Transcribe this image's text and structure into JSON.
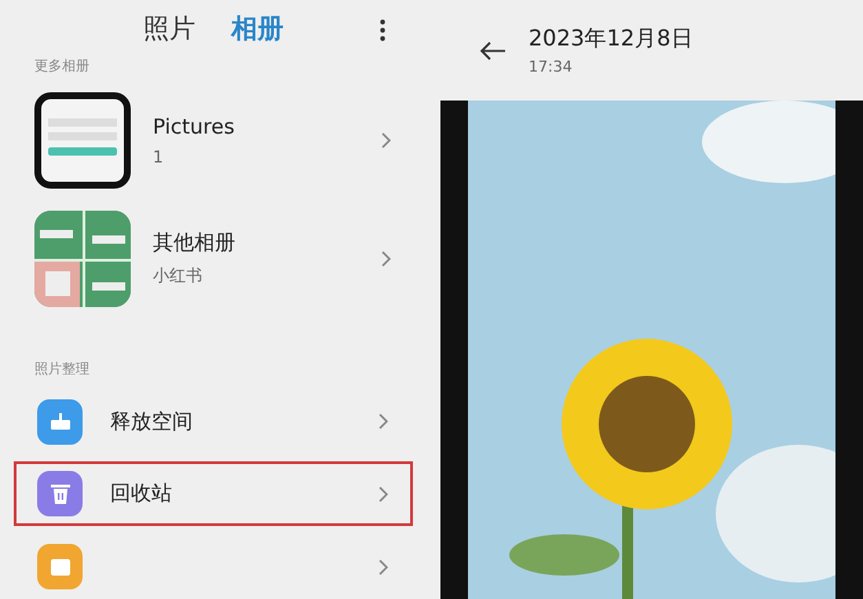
{
  "tabs": [
    {
      "label": "照片",
      "selected": false
    },
    {
      "label": "相册",
      "selected": true
    }
  ],
  "album_section": {
    "title": "更多相册"
  },
  "albums": [
    {
      "kind": "screenshot",
      "title": "Pictures",
      "subtitle": "1"
    },
    {
      "kind": "collage",
      "title": "其他相册",
      "subtitle": "小红书"
    }
  ],
  "tools_section": {
    "title": "照片整理"
  },
  "tools": [
    {
      "kind": "broom",
      "label": "释放空间",
      "color": "#3d9be9",
      "highlighted": false
    },
    {
      "kind": "trash",
      "label": "回收站",
      "color": "#8a7ce6",
      "highlighted": true
    },
    {
      "kind": "generic",
      "color": "#f0a630",
      "highlighted": false
    }
  ],
  "viewer": {
    "date": "2023年12月8日",
    "time": "17:34"
  }
}
